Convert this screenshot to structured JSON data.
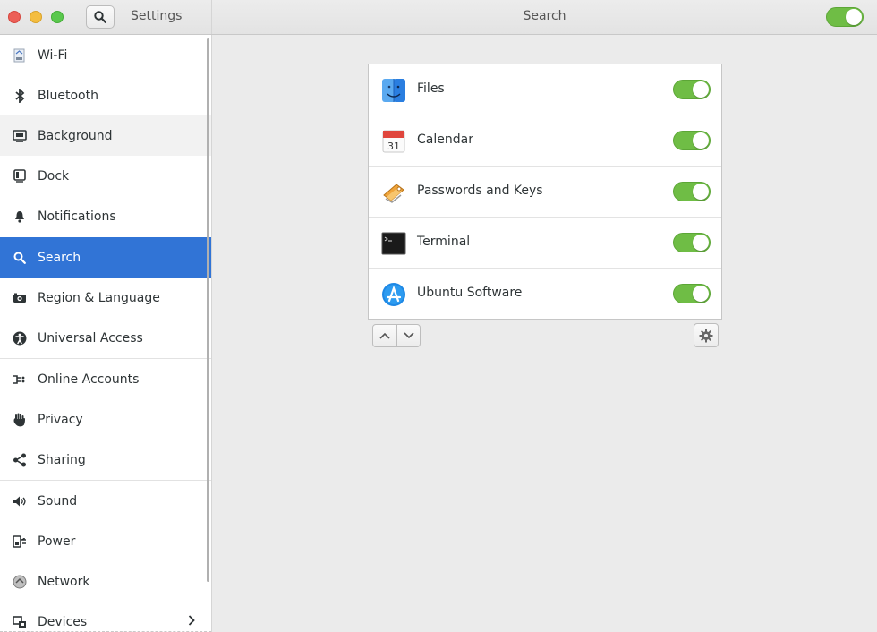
{
  "window": {
    "app_title": "Settings",
    "page_title": "Search",
    "search_enabled": true
  },
  "sidebar": {
    "items": [
      {
        "label": "Wi-Fi",
        "icon": "wifi-icon"
      },
      {
        "label": "Bluetooth",
        "icon": "bluetooth-icon"
      },
      {
        "label": "Background",
        "icon": "background-icon"
      },
      {
        "label": "Dock",
        "icon": "dock-icon"
      },
      {
        "label": "Notifications",
        "icon": "bell-icon"
      },
      {
        "label": "Search",
        "icon": "search-icon"
      },
      {
        "label": "Region & Language",
        "icon": "camera-icon"
      },
      {
        "label": "Universal Access",
        "icon": "accessibility-icon"
      },
      {
        "label": "Online Accounts",
        "icon": "online-accounts-icon"
      },
      {
        "label": "Privacy",
        "icon": "hand-icon"
      },
      {
        "label": "Sharing",
        "icon": "share-icon"
      },
      {
        "label": "Sound",
        "icon": "speaker-icon"
      },
      {
        "label": "Power",
        "icon": "power-plug-icon"
      },
      {
        "label": "Network",
        "icon": "network-icon"
      },
      {
        "label": "Devices",
        "icon": "devices-icon"
      }
    ],
    "active": "Search",
    "hovered": "Background"
  },
  "search_sources": [
    {
      "name": "Files",
      "icon": "files-app-icon",
      "enabled": true
    },
    {
      "name": "Calendar",
      "icon": "calendar-app-icon",
      "enabled": true
    },
    {
      "name": "Passwords and Keys",
      "icon": "passwords-keys-app-icon",
      "enabled": true
    },
    {
      "name": "Terminal",
      "icon": "terminal-app-icon",
      "enabled": true
    },
    {
      "name": "Ubuntu Software",
      "icon": "ubuntu-software-app-icon",
      "enabled": true
    }
  ],
  "calendar_icon_day": "31",
  "colors": {
    "accent": "#3174d6",
    "switch_on": "#6fbd45"
  }
}
